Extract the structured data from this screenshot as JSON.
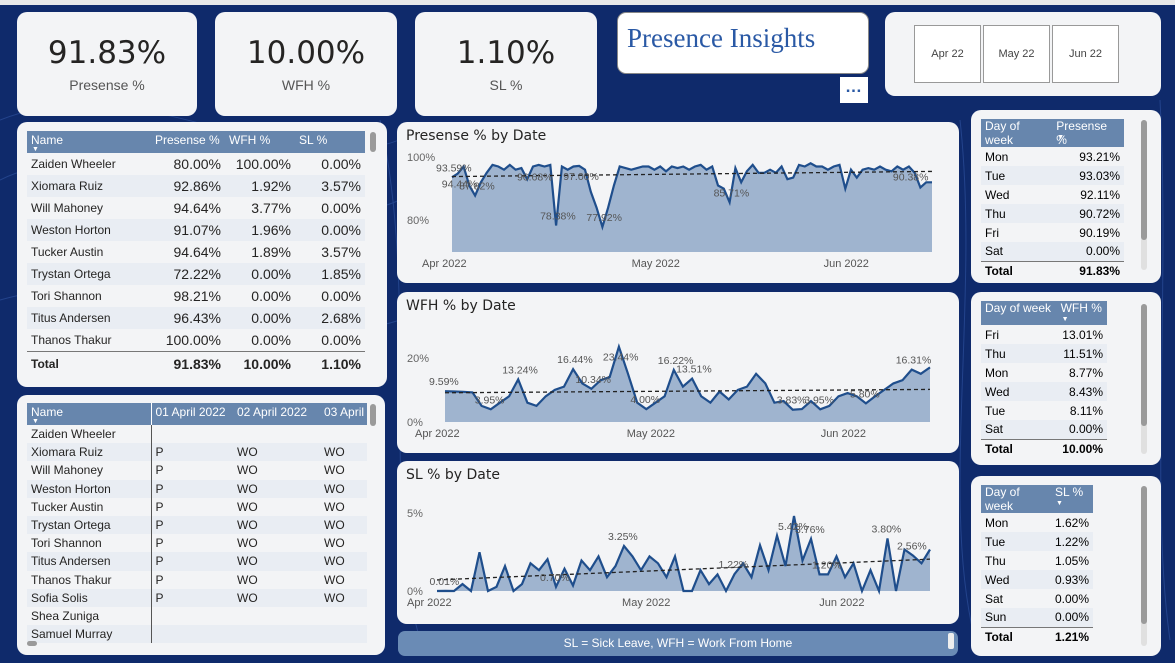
{
  "kpis": [
    {
      "value": "91.83%",
      "label": "Presense %"
    },
    {
      "value": "10.00%",
      "label": "WFH %"
    },
    {
      "value": "1.10%",
      "label": "SL %"
    }
  ],
  "title": "Presence Insights",
  "more_label": "…",
  "months": [
    "Apr 22",
    "May 22",
    "Jun 22"
  ],
  "summary_table": {
    "headers": [
      "Name",
      "Presense %",
      "WFH %",
      "SL %"
    ],
    "rows": [
      [
        "Zaiden Wheeler",
        "80.00%",
        "100.00%",
        "0.00%"
      ],
      [
        "Xiomara Ruiz",
        "92.86%",
        "1.92%",
        "3.57%"
      ],
      [
        "Will Mahoney",
        "94.64%",
        "3.77%",
        "0.00%"
      ],
      [
        "Weston Horton",
        "91.07%",
        "1.96%",
        "0.00%"
      ],
      [
        "Tucker Austin",
        "94.64%",
        "1.89%",
        "3.57%"
      ],
      [
        "Trystan Ortega",
        "72.22%",
        "0.00%",
        "1.85%"
      ],
      [
        "Tori Shannon",
        "98.21%",
        "0.00%",
        "0.00%"
      ],
      [
        "Titus Andersen",
        "96.43%",
        "0.00%",
        "2.68%"
      ],
      [
        "Thanos Thakur",
        "100.00%",
        "0.00%",
        "0.00%"
      ]
    ],
    "total": [
      "Total",
      "91.83%",
      "10.00%",
      "1.10%"
    ]
  },
  "daily_table": {
    "headers": [
      "Name",
      "01 April 2022",
      "02 April 2022",
      "03 April"
    ],
    "rows": [
      [
        "Zaiden Wheeler",
        "",
        "",
        ""
      ],
      [
        "Xiomara Ruiz",
        "P",
        "WO",
        "WO"
      ],
      [
        "Will Mahoney",
        "P",
        "WO",
        "WO"
      ],
      [
        "Weston Horton",
        "P",
        "WO",
        "WO"
      ],
      [
        "Tucker Austin",
        "P",
        "WO",
        "WO"
      ],
      [
        "Trystan Ortega",
        "P",
        "WO",
        "WO"
      ],
      [
        "Tori Shannon",
        "P",
        "WO",
        "WO"
      ],
      [
        "Titus Andersen",
        "P",
        "WO",
        "WO"
      ],
      [
        "Thanos Thakur",
        "P",
        "WO",
        "WO"
      ],
      [
        "Sofia Solis",
        "P",
        "WO",
        "WO"
      ],
      [
        "Shea Zuniga",
        "",
        "",
        ""
      ],
      [
        "Samuel Murray",
        "",
        "",
        ""
      ]
    ]
  },
  "dow_presense": {
    "headers": [
      "Day of week",
      "Presense %"
    ],
    "rows": [
      [
        "Mon",
        "93.21%"
      ],
      [
        "Tue",
        "93.03%"
      ],
      [
        "Wed",
        "92.11%"
      ],
      [
        "Thu",
        "90.72%"
      ],
      [
        "Fri",
        "90.19%"
      ],
      [
        "Sat",
        "0.00%"
      ]
    ],
    "total": [
      "Total",
      "91.83%"
    ]
  },
  "dow_wfh": {
    "headers": [
      "Day of week",
      "WFH %"
    ],
    "rows": [
      [
        "Fri",
        "13.01%"
      ],
      [
        "Thu",
        "11.51%"
      ],
      [
        "Mon",
        "8.77%"
      ],
      [
        "Wed",
        "8.43%"
      ],
      [
        "Tue",
        "8.11%"
      ],
      [
        "Sat",
        "0.00%"
      ]
    ],
    "total": [
      "Total",
      "10.00%"
    ]
  },
  "dow_sl": {
    "headers": [
      "Day of week",
      "SL %"
    ],
    "rows": [
      [
        "Mon",
        "1.62%"
      ],
      [
        "Tue",
        "1.22%"
      ],
      [
        "Thu",
        "1.05%"
      ],
      [
        "Wed",
        "0.93%"
      ],
      [
        "Sat",
        "0.00%"
      ],
      [
        "Sun",
        "0.00%"
      ]
    ],
    "total": [
      "Total",
      "1.21%"
    ]
  },
  "note": "SL = Sick Leave, WFH = Work From Home",
  "chart_data": [
    {
      "type": "area",
      "title": "Presense % by Date",
      "x_ticks": [
        "Apr 2022",
        "May 2022",
        "Jun 2022"
      ],
      "y_ticks": [
        "100%",
        "80%"
      ],
      "ylim": [
        70,
        100
      ],
      "trendline": true,
      "values": [
        93.59,
        94.8,
        97,
        91,
        87.82,
        92,
        95,
        97.5,
        97,
        96,
        97.5,
        96,
        96.5,
        93,
        97,
        97.5,
        97,
        97.5,
        78.38,
        97,
        96,
        97,
        97.2,
        96,
        89,
        84,
        77.92,
        84,
        91,
        97,
        96.5,
        96,
        96.5,
        97,
        97,
        96,
        97,
        95.5,
        97,
        96.5,
        97,
        96,
        97,
        97.5,
        96,
        97,
        91,
        90,
        85.71,
        96.5,
        92,
        95.5,
        97.5,
        95,
        95,
        96,
        95,
        97,
        93,
        93.5,
        97.5,
        97,
        98,
        97,
        97,
        96,
        97,
        97.5,
        90,
        96,
        93.5,
        96,
        96.5,
        96,
        97,
        96,
        95.5,
        97,
        96,
        97,
        95,
        90.38,
        92,
        92
      ],
      "labels": [
        {
          "i": 1,
          "text": "94.44%"
        },
        {
          "i": 0,
          "text": "93.59%"
        },
        {
          "i": 4,
          "text": "87.82%"
        },
        {
          "i": 14,
          "text": "96.68%"
        },
        {
          "i": 18,
          "text": "78.38%"
        },
        {
          "i": 22,
          "text": "97.00%"
        },
        {
          "i": 26,
          "text": "77.92%"
        },
        {
          "i": 48,
          "text": "85.71%"
        },
        {
          "i": 79,
          "text": "90.38%"
        }
      ]
    },
    {
      "type": "area",
      "title": "WFH % by Date",
      "x_ticks": [
        "Apr 2022",
        "May 2022",
        "Jun 2022"
      ],
      "y_ticks": [
        "20%",
        "0%"
      ],
      "ylim": [
        0,
        28
      ],
      "trendline": true,
      "values": [
        9.59,
        9.5,
        9.4,
        9.2,
        5,
        3.95,
        6,
        8,
        13.24,
        6,
        5,
        8,
        10,
        11,
        16.44,
        12,
        10.34,
        13,
        14,
        23.44,
        15,
        6,
        4.0,
        6,
        8,
        16.22,
        11,
        13.51,
        8,
        6,
        9.5,
        7,
        10,
        11,
        15,
        12,
        6,
        6.5,
        3.83,
        4,
        6.5,
        3.95,
        5,
        8,
        9,
        8,
        5.8,
        8,
        10,
        12,
        13,
        16.31,
        15,
        17
      ],
      "labels": [
        {
          "i": 0,
          "text": "9.59%"
        },
        {
          "i": 5,
          "text": "3.95%"
        },
        {
          "i": 8,
          "text": "13.24%"
        },
        {
          "i": 14,
          "text": "16.44%"
        },
        {
          "i": 16,
          "text": "10.34%"
        },
        {
          "i": 19,
          "text": "23.44%"
        },
        {
          "i": 22,
          "text": "4.00%"
        },
        {
          "i": 25,
          "text": "16.22%"
        },
        {
          "i": 27,
          "text": "13.51%"
        },
        {
          "i": 38,
          "text": "3.83%"
        },
        {
          "i": 41,
          "text": "3.95%"
        },
        {
          "i": 46,
          "text": "5.80%"
        },
        {
          "i": 51,
          "text": "16.31%"
        }
      ]
    },
    {
      "type": "area",
      "title": "SL % by Date",
      "x_ticks": [
        "Apr 2022",
        "May 2022",
        "Jun 2022"
      ],
      "y_ticks": [
        "5%",
        "0%"
      ],
      "ylim": [
        0,
        6.5
      ],
      "trendline": true,
      "values": [
        0,
        0.01,
        0,
        0.5,
        0,
        2.8,
        0,
        0.3,
        1.8,
        0,
        0.5,
        2,
        1.5,
        2.3,
        0.3,
        1.6,
        0.4,
        2.2,
        1.5,
        2.5,
        1,
        1.8,
        3.25,
        2.5,
        1.5,
        2.5,
        2,
        1,
        2.5,
        0,
        0,
        1.5,
        0.5,
        1.2,
        0,
        1.22,
        2,
        1,
        3.3,
        1.5,
        4,
        1.8,
        5.42,
        2.2,
        3.76,
        1.2,
        1.2,
        2.5,
        1,
        2,
        0,
        1.5,
        0,
        3.8,
        0,
        3,
        2.56,
        2,
        3
      ],
      "labels": [
        {
          "i": 1,
          "text": "0.01%"
        },
        {
          "i": 22,
          "text": "3.25%"
        },
        {
          "i": 14,
          "text": "0.70%"
        },
        {
          "i": 35,
          "text": "1.22%"
        },
        {
          "i": 42,
          "text": "5.42%"
        },
        {
          "i": 44,
          "text": "3.76%"
        },
        {
          "i": 46,
          "text": "1.20%"
        },
        {
          "i": 53,
          "text": "3.80%"
        },
        {
          "i": 56,
          "text": "2.56%"
        }
      ]
    }
  ]
}
